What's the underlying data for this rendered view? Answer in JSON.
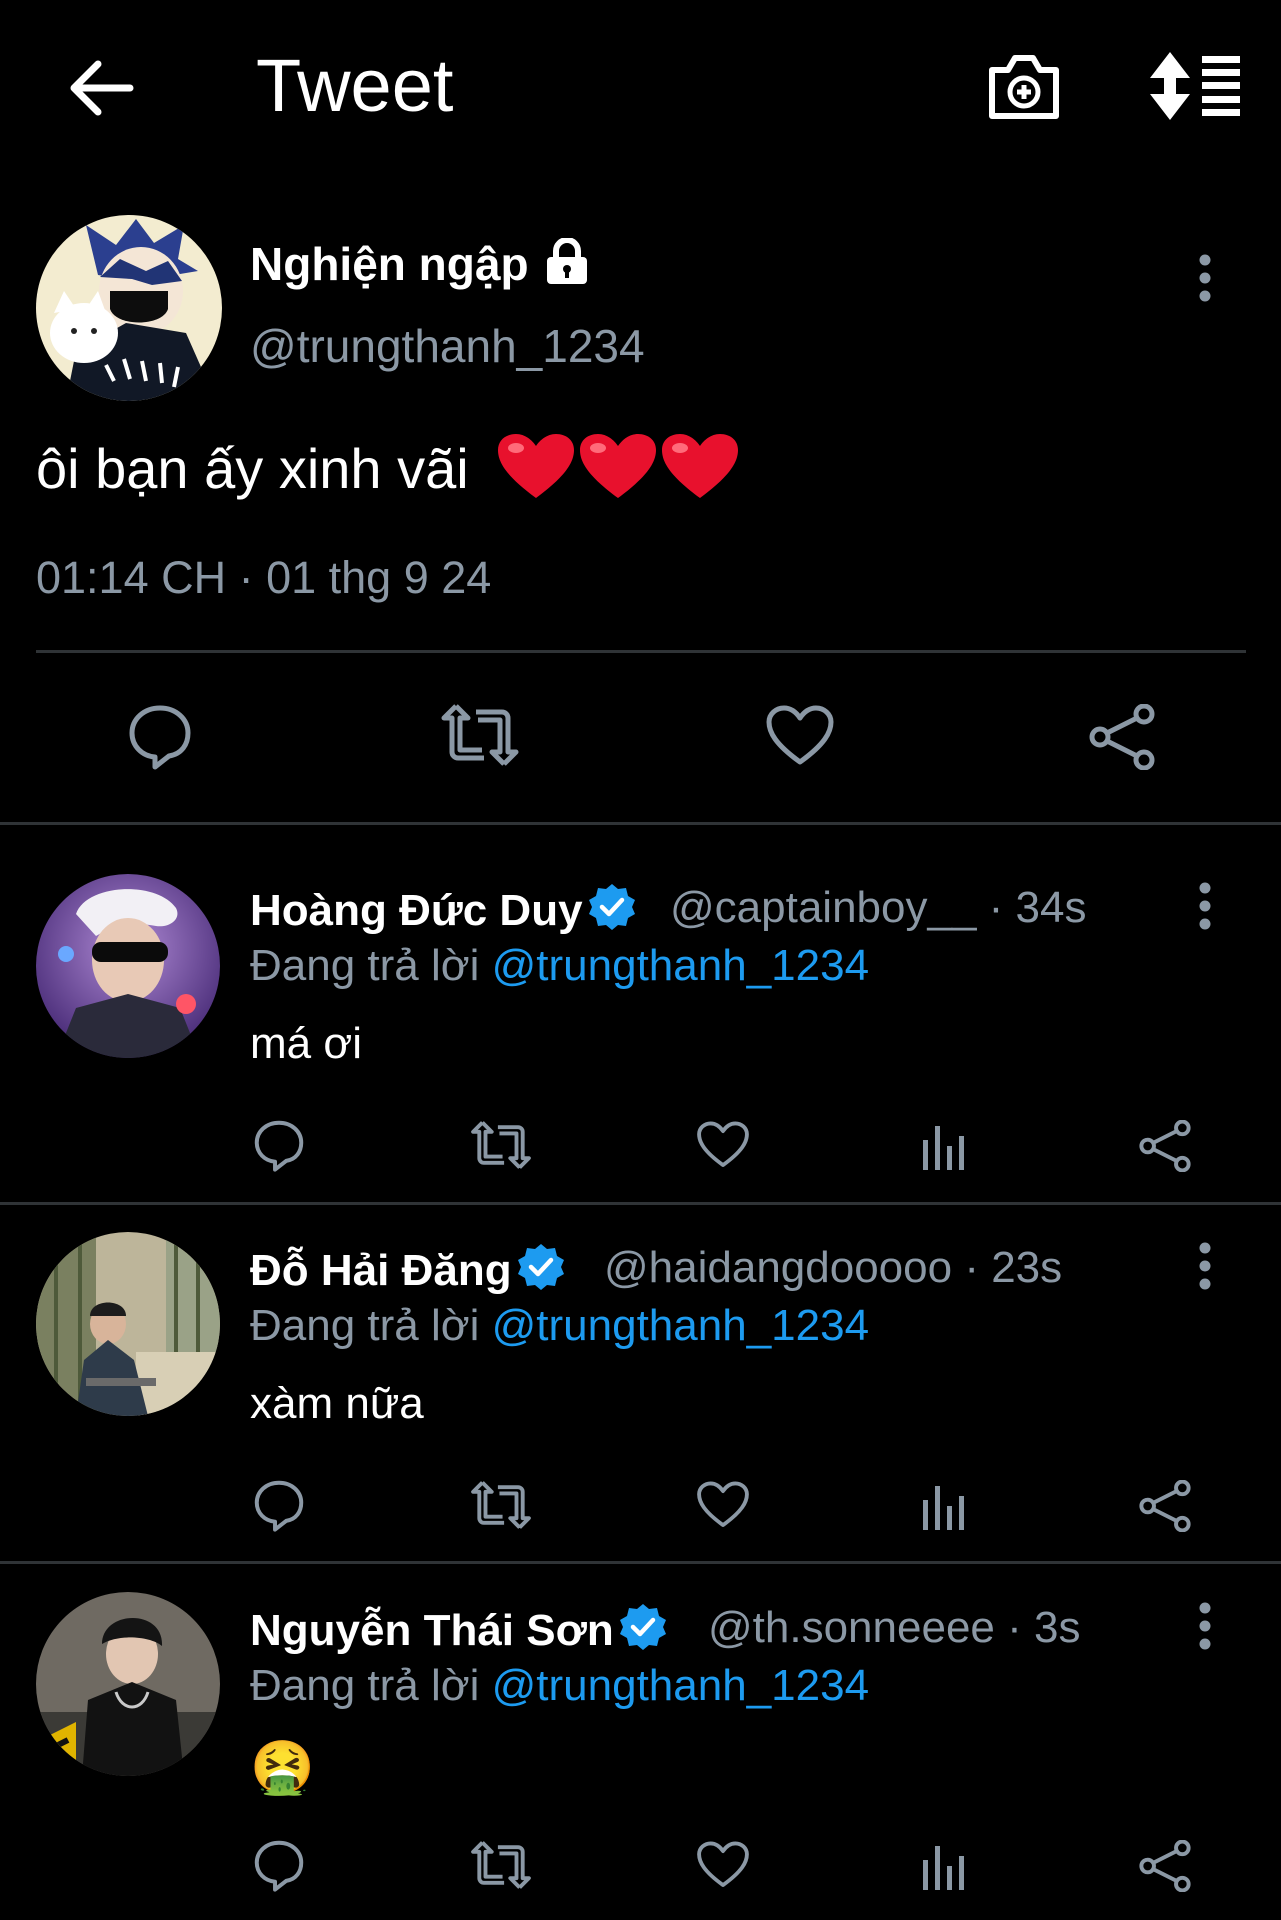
{
  "header": {
    "title": "Tweet"
  },
  "tweet": {
    "author_name": "Nghiện ngập",
    "author_handle": "@trungthanh_1234",
    "text": "ôi bạn ấy xinh vãi",
    "emoji": "❤️❤️❤️",
    "timestamp": "01:14 CH · 01 thg 9 24"
  },
  "replies": [
    {
      "name": "Hoàng Đức Duy",
      "handle_time": "@captainboy__ · 34s",
      "replying_label": "Đang trả lời",
      "replying_to": "@trungthanh_1234",
      "text": "má ơi"
    },
    {
      "name": "Đỗ Hải Đăng",
      "handle_time": "@haidangdooooo · 23s",
      "replying_label": "Đang trả lời",
      "replying_to": "@trungthanh_1234",
      "text": "xàm nữa"
    },
    {
      "name": "Nguyễn Thái Sơn",
      "handle_time": "@th.sonneeee · 3s",
      "replying_label": "Đang trả lời",
      "replying_to": "@trungthanh_1234",
      "text": "🤮"
    }
  ],
  "colors": {
    "background": "#000000",
    "muted": "#8b98a5",
    "accent": "#1d9bf0",
    "heart": "#e8112d"
  }
}
